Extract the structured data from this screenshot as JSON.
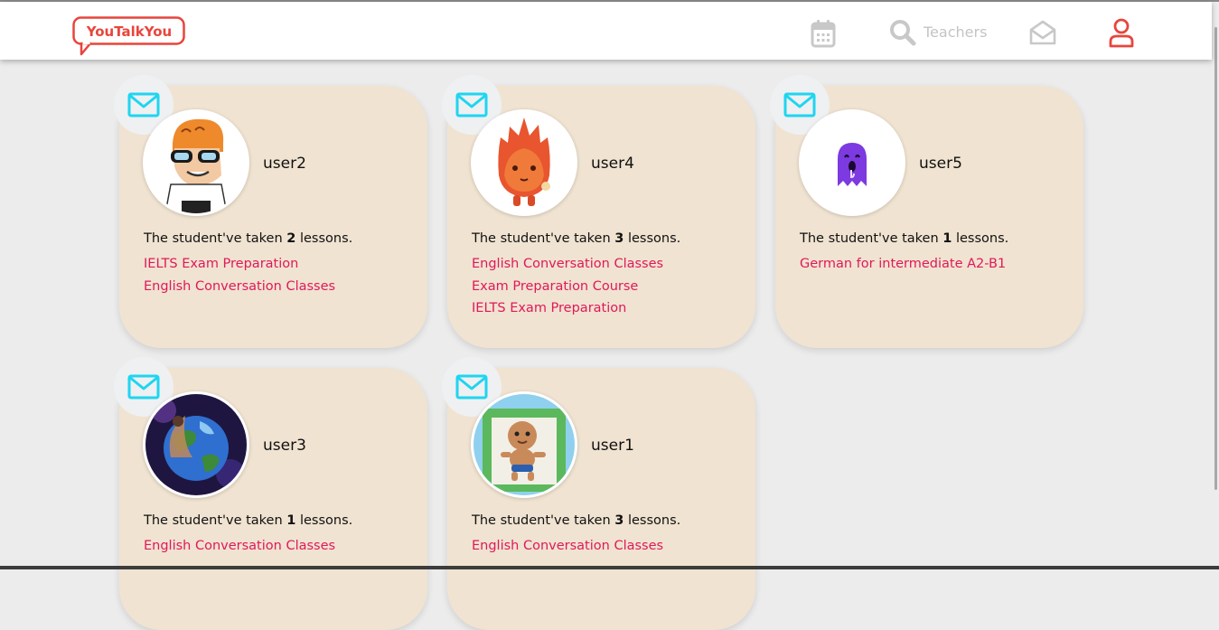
{
  "brand": {
    "logo_text": "YouTalkYou"
  },
  "nav": {
    "teachers_label": "Teachers",
    "icons": [
      "calendar-icon",
      "search-icon",
      "mail-open-icon",
      "user-icon"
    ]
  },
  "students": [
    {
      "username": "user2",
      "lessons_prefix": "The student've taken",
      "lesson_count": "2",
      "lessons_suffix": "lessons.",
      "courses": [
        "IELTS Exam Preparation",
        "English Conversation Classes"
      ]
    },
    {
      "username": "user4",
      "lessons_prefix": "The student've taken",
      "lesson_count": "3",
      "lessons_suffix": "lessons.",
      "courses": [
        "English Conversation Classes",
        "Exam Preparation Course",
        "IELTS Exam Preparation"
      ]
    },
    {
      "username": "user5",
      "lessons_prefix": "The student've taken",
      "lesson_count": "1",
      "lessons_suffix": "lessons.",
      "courses": [
        "German for intermediate A2-B1"
      ]
    },
    {
      "username": "user3",
      "lessons_prefix": "The student've taken",
      "lesson_count": "1",
      "lessons_suffix": "lessons.",
      "courses": [
        "English Conversation Classes"
      ]
    },
    {
      "username": "user1",
      "lessons_prefix": "The student've taken",
      "lesson_count": "3",
      "lessons_suffix": "lessons.",
      "courses": [
        "English Conversation Classes"
      ]
    }
  ],
  "colors": {
    "brand_red": "#e8453c",
    "card_bg": "#f0e3d1",
    "course_link": "#e0195a",
    "mail_icon": "#1fd5f0",
    "nav_icon_gray": "#c8c8c8"
  }
}
